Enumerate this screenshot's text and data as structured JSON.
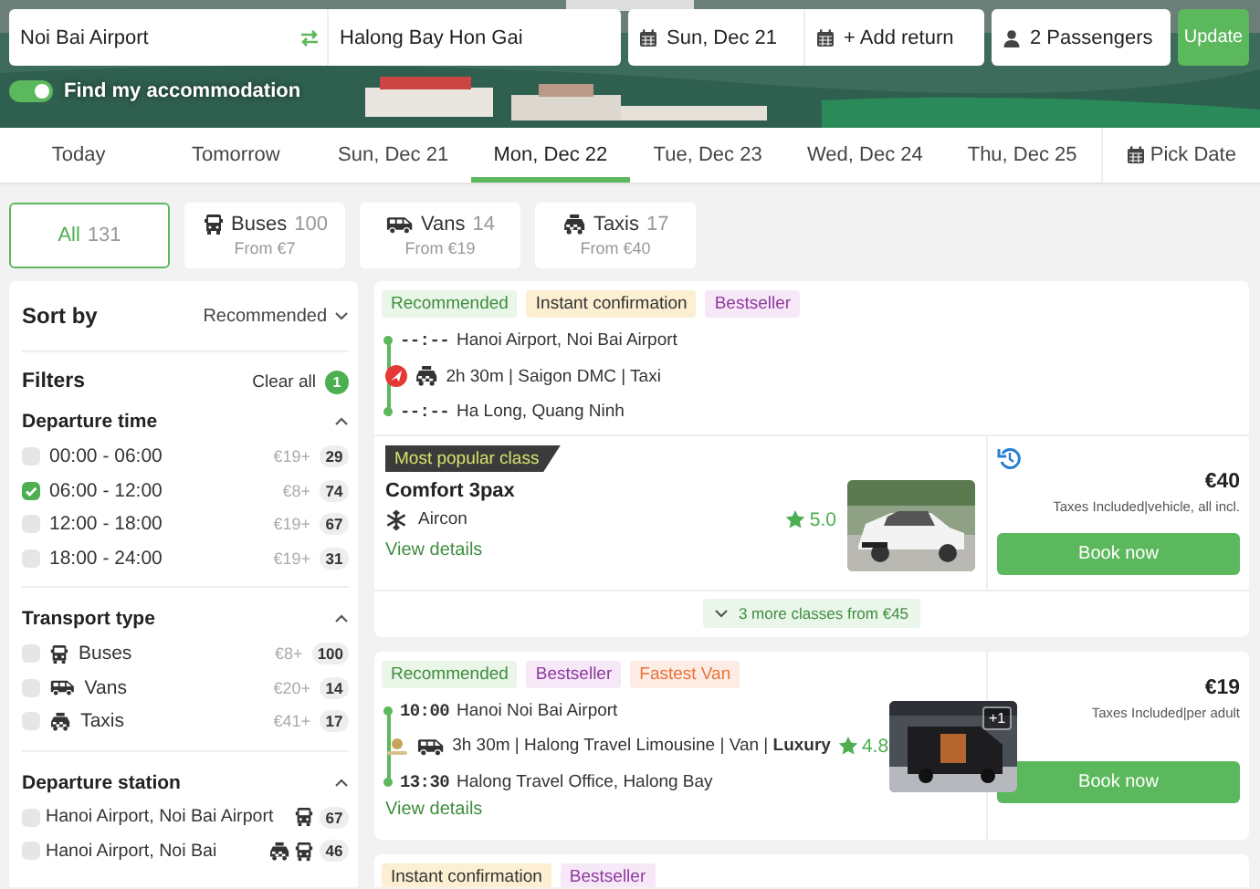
{
  "search": {
    "from": "Noi Bai Airport",
    "to": "Halong Bay Hon Gai",
    "date": "Sun, Dec 21",
    "return": "+ Add return",
    "passengers": "2 Passengers",
    "button": "Update"
  },
  "accommodation_toggle": {
    "label": "Find my accommodation",
    "on": true
  },
  "date_tabs": [
    {
      "label": "Today",
      "selected": false
    },
    {
      "label": "Tomorrow",
      "selected": false
    },
    {
      "label": "Sun, Dec 21",
      "selected": false
    },
    {
      "label": "Mon, Dec 22",
      "selected": true
    },
    {
      "label": "Tue, Dec 23",
      "selected": false
    },
    {
      "label": "Wed, Dec 24",
      "selected": false
    },
    {
      "label": "Thu, Dec 25",
      "selected": false
    }
  ],
  "pick_date": "Pick Date",
  "transport_tabs": [
    {
      "kind": "all",
      "label": "All",
      "count": "131",
      "selected": true
    },
    {
      "kind": "bus",
      "label": "Buses",
      "count": "100",
      "price": "From €7",
      "selected": false
    },
    {
      "kind": "van",
      "label": "Vans",
      "count": "14",
      "price": "From €19",
      "selected": false
    },
    {
      "kind": "taxi",
      "label": "Taxis",
      "count": "17",
      "price": "From €40",
      "selected": false
    }
  ],
  "sidebar": {
    "sort_label": "Sort by",
    "sort_value": "Recommended",
    "filters_title": "Filters",
    "clear_all": "Clear all",
    "filter_count": "1",
    "groups": [
      {
        "title": "Departure time",
        "expanded": true,
        "options": [
          {
            "label": "00:00 - 06:00",
            "price": "€19+",
            "count": "29",
            "checked": false
          },
          {
            "label": "06:00 - 12:00",
            "price": "€8+",
            "count": "74",
            "checked": true
          },
          {
            "label": "12:00 - 18:00",
            "price": "€19+",
            "count": "67",
            "checked": false
          },
          {
            "label": "18:00 - 24:00",
            "price": "€19+",
            "count": "31",
            "checked": false
          }
        ]
      },
      {
        "title": "Transport type",
        "expanded": true,
        "options": [
          {
            "label": "Buses",
            "icons": [
              {
                "kind": "bus"
              }
            ],
            "price": "€8+",
            "count": "100",
            "checked": false
          },
          {
            "label": "Vans",
            "icons": [
              {
                "kind": "van"
              }
            ],
            "price": "€20+",
            "count": "14",
            "checked": false
          },
          {
            "label": "Taxis",
            "icons": [
              {
                "kind": "taxi"
              }
            ],
            "price": "€41+",
            "count": "17",
            "checked": false
          }
        ]
      },
      {
        "title": "Departure station",
        "expanded": true,
        "options": [
          {
            "label": "Hanoi Airport, Noi Bai Airport",
            "icons": [
              {
                "kind": "bus"
              }
            ],
            "count": "67",
            "checked": false
          },
          {
            "label": "Hanoi Airport, Noi Bai",
            "icons": [
              {
                "kind": "taxi"
              },
              {
                "kind": "bus"
              }
            ],
            "count": "46",
            "checked": false
          }
        ]
      }
    ]
  },
  "results": [
    {
      "kind": "multi_class",
      "tags": [
        {
          "kind": "recommended",
          "label": "Recommended"
        },
        {
          "kind": "instant",
          "label": "Instant confirmation"
        },
        {
          "kind": "bestseller",
          "label": "Bestseller"
        }
      ],
      "route": {
        "departure_time": "--:--",
        "departure": "Hanoi Airport, Noi Bai Airport",
        "operator": {
          "kind": "plane"
        },
        "vehicle": {
          "kind": "taxi"
        },
        "info": "2h 30m | Saigon DMC | Taxi",
        "arrival_time": "--:--",
        "arrival": "Ha Long, Quang Ninh"
      },
      "class_badge": "Most popular class",
      "class_name": "Comfort 3pax",
      "amenity": "Aircon",
      "rating": "5.0",
      "photo": {
        "kind": "picture"
      },
      "view_details": "View details",
      "price": "€40",
      "price_note": "Taxes Included|vehicle, all incl.",
      "book": "Book now",
      "more_classes": "3 more classes from €45"
    },
    {
      "kind": "single",
      "tags": [
        {
          "kind": "recommended",
          "label": "Recommended"
        },
        {
          "kind": "bestseller",
          "label": "Bestseller"
        },
        {
          "kind": "fastest",
          "label": "Fastest Van"
        }
      ],
      "route": {
        "departure_time": "10:00",
        "departure": "Hanoi Noi Bai Airport",
        "operator": {
          "kind": "emblem"
        },
        "vehicle": {
          "kind": "van"
        },
        "info": "3h 30m | Halong Travel Limousine | Van | **Luxury**",
        "arrival_time": "13:30",
        "arrival": "Halong Travel Office, Halong Bay"
      },
      "rating": "4.8",
      "photo": {
        "kind": "picture",
        "count": "+1"
      },
      "view_details": "View details",
      "price": "€19",
      "price_note": "Taxes Included|per adult",
      "book": "Book now"
    },
    {
      "kind": "tags_only",
      "tags": [
        {
          "kind": "instant",
          "label": "Instant confirmation"
        },
        {
          "kind": "bestseller",
          "label": "Bestseller"
        }
      ]
    }
  ]
}
